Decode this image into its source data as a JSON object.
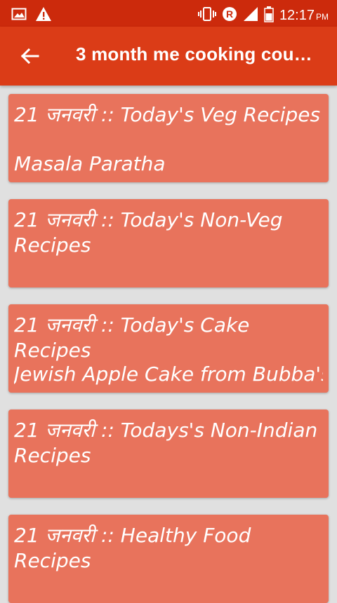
{
  "status_bar": {
    "time": "12:17",
    "ampm": "PM",
    "icons": [
      "gallery-icon",
      "warning-icon",
      "vibrate-icon",
      "roaming-icon",
      "signal-icon",
      "battery-icon"
    ]
  },
  "app_bar": {
    "back_icon": "arrow-back-icon",
    "title": "3 month me cooking cou…"
  },
  "colors": {
    "status_bar": "#cc2a0c",
    "app_bar": "#db3c17",
    "card": "#e8735c",
    "background": "#e0e0e0"
  },
  "cards": [
    {
      "title": "21 जनवरी :: Today's Veg Recipes",
      "subtitle": "Masala Paratha"
    },
    {
      "title": "21 जनवरी :: Today's Non-Veg Recipes",
      "subtitle": ""
    },
    {
      "title": "21 जनवरी :: Today's Cake Recipes",
      "subtitle": "Jewish Apple Cake from Bubba's"
    },
    {
      "title": "21 जनवरी :: Todays's Non-Indian Recipes",
      "subtitle": ""
    },
    {
      "title": "21 जनवरी :: Healthy Food Recipes",
      "subtitle": ""
    }
  ]
}
